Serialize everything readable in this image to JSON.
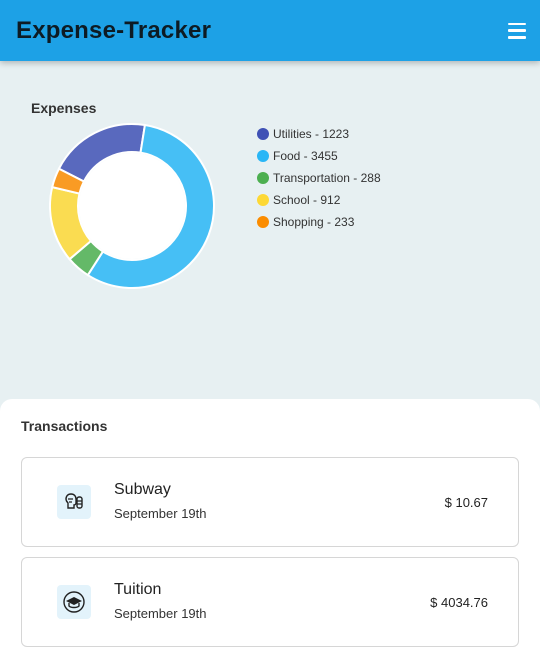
{
  "app": {
    "title": "Expense-Tracker",
    "menu_icon": "hamburger-icon"
  },
  "expenses": {
    "title": "Expenses",
    "chart_data": {
      "type": "pie",
      "categories": [
        "Utilities",
        "Food",
        "Transportation",
        "School",
        "Shopping"
      ],
      "values": [
        1223,
        3455,
        288,
        912,
        233
      ],
      "colors": [
        "#3f51b5",
        "#29b6f6",
        "#4caf50",
        "#fdd835",
        "#fb8c00"
      ],
      "legend_labels": [
        "Utilities - 1223",
        "Food - 3455",
        "Transportation - 288",
        "School - 912",
        "Shopping - 233"
      ],
      "legend_position": "right"
    }
  },
  "transactions": {
    "title": "Transactions",
    "items": [
      {
        "name": "Subway",
        "date": "September 19th",
        "amount": "$ 10.67",
        "icon": "food-icon"
      },
      {
        "name": "Tuition",
        "date": "September 19th",
        "amount": "$ 4034.76",
        "icon": "graduation-cap-icon"
      }
    ]
  }
}
